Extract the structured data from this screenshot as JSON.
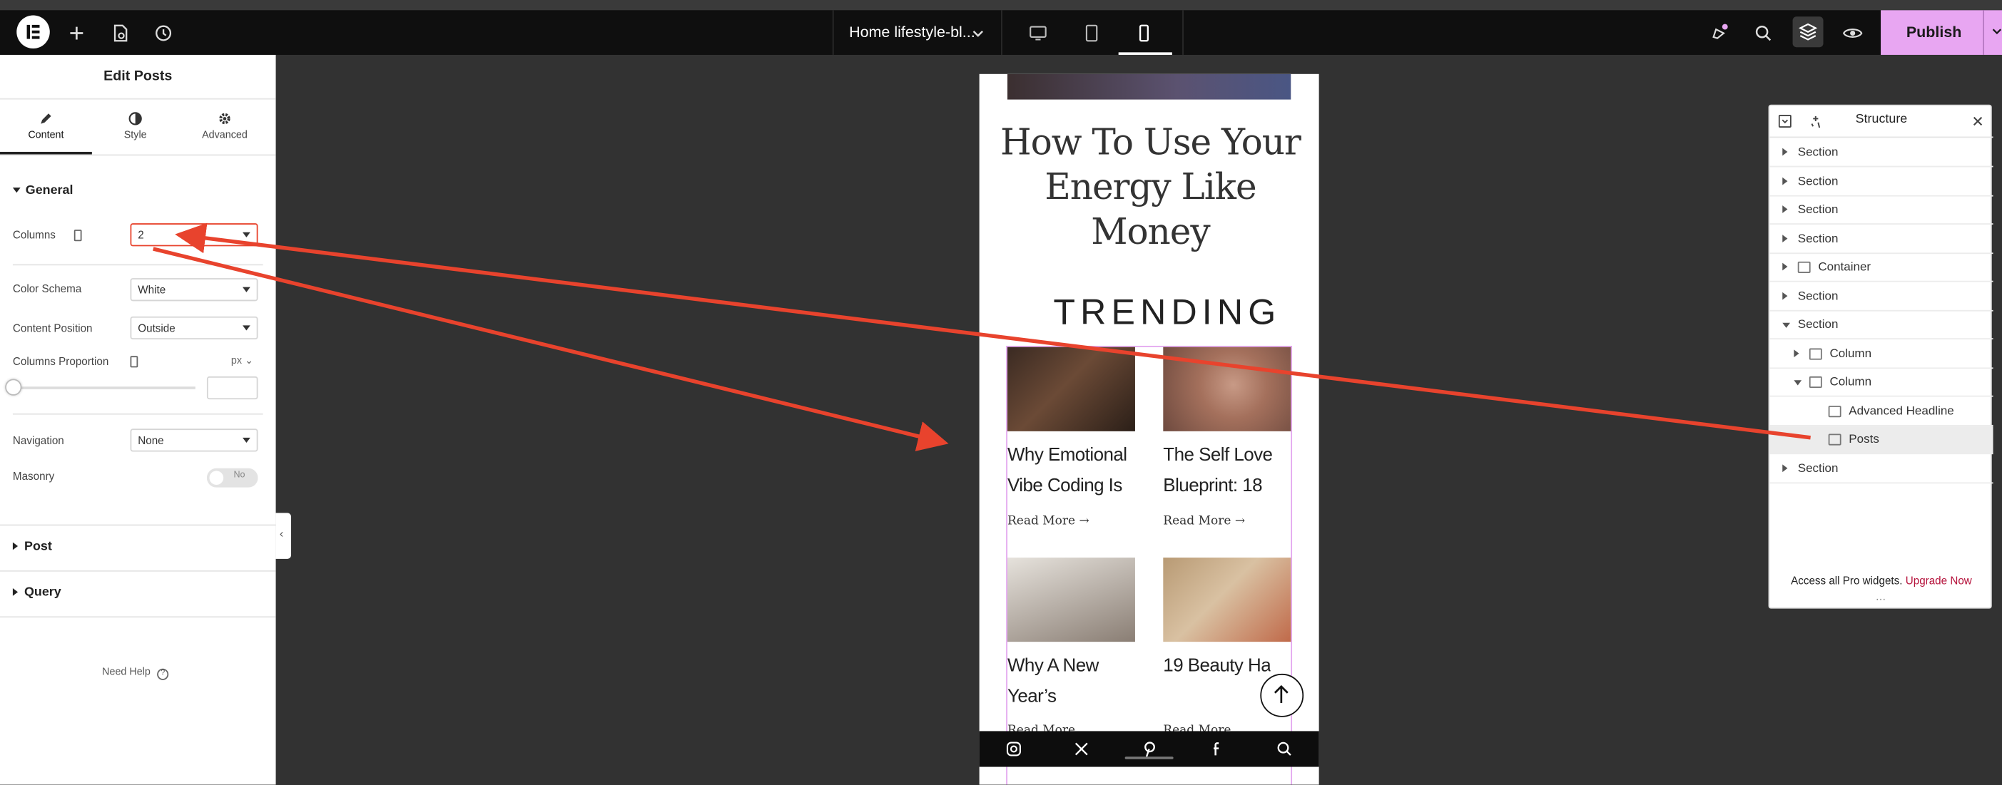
{
  "topbar": {
    "doc_name": "Home lifestyle-bl...",
    "publish_label": "Publish"
  },
  "panel": {
    "title": "Edit Posts",
    "tabs": [
      {
        "label": "Content",
        "icon": "pencil-icon"
      },
      {
        "label": "Style",
        "icon": "half-circle-icon"
      },
      {
        "label": "Advanced",
        "icon": "gear-icon"
      }
    ],
    "general": {
      "heading": "General",
      "columns_label": "Columns",
      "columns_value": "2",
      "color_schema_label": "Color Schema",
      "color_schema_value": "White",
      "content_position_label": "Content Position",
      "content_position_value": "Outside",
      "columns_proportion_label": "Columns Proportion",
      "columns_proportion_unit": "px",
      "columns_proportion_value": 0,
      "navigation_label": "Navigation",
      "navigation_value": "None",
      "masonry_label": "Masonry",
      "masonry_value": "No"
    },
    "post_heading": "Post",
    "query_heading": "Query",
    "need_help": "Need Help"
  },
  "preview": {
    "headline": "How To Use Your Energy Like Money",
    "trending": "TRENDING",
    "posts": [
      {
        "title": "Why Emotional Vibe Coding Is",
        "read_more": "Read More"
      },
      {
        "title": "The Self Love Blueprint: 18",
        "read_more": "Read More"
      },
      {
        "title": "Why A New Year’s",
        "read_more": "Read More"
      },
      {
        "title": "19 Beauty Hacks You C",
        "read_more": "Read More"
      }
    ]
  },
  "structure": {
    "title": "Structure",
    "items": [
      {
        "label": "Section",
        "level": 0,
        "state": "collapsed",
        "icon": ""
      },
      {
        "label": "Section",
        "level": 0,
        "state": "collapsed",
        "icon": ""
      },
      {
        "label": "Section",
        "level": 0,
        "state": "collapsed",
        "icon": ""
      },
      {
        "label": "Section",
        "level": 0,
        "state": "collapsed",
        "icon": ""
      },
      {
        "label": "Container",
        "level": 0,
        "state": "collapsed",
        "icon": "container-icon"
      },
      {
        "label": "Section",
        "level": 0,
        "state": "collapsed",
        "icon": ""
      },
      {
        "label": "Section",
        "level": 0,
        "state": "expanded",
        "icon": ""
      },
      {
        "label": "Column",
        "level": 1,
        "state": "collapsed",
        "icon": "column-icon"
      },
      {
        "label": "Column",
        "level": 1,
        "state": "expanded",
        "icon": "column-icon"
      },
      {
        "label": "Advanced Headline",
        "level": 2,
        "state": "leaf",
        "icon": "headline-icon"
      },
      {
        "label": "Posts",
        "level": 2,
        "state": "selected",
        "icon": "posts-icon"
      },
      {
        "label": "Section",
        "level": 0,
        "state": "collapsed",
        "icon": ""
      }
    ],
    "promo_text": "Access all Pro widgets.",
    "promo_link": "Upgrade Now"
  },
  "colors": {
    "publish": "#e8a6f2",
    "annotation_arrow": "#e8432d",
    "upgrade_link": "#b5123b"
  }
}
